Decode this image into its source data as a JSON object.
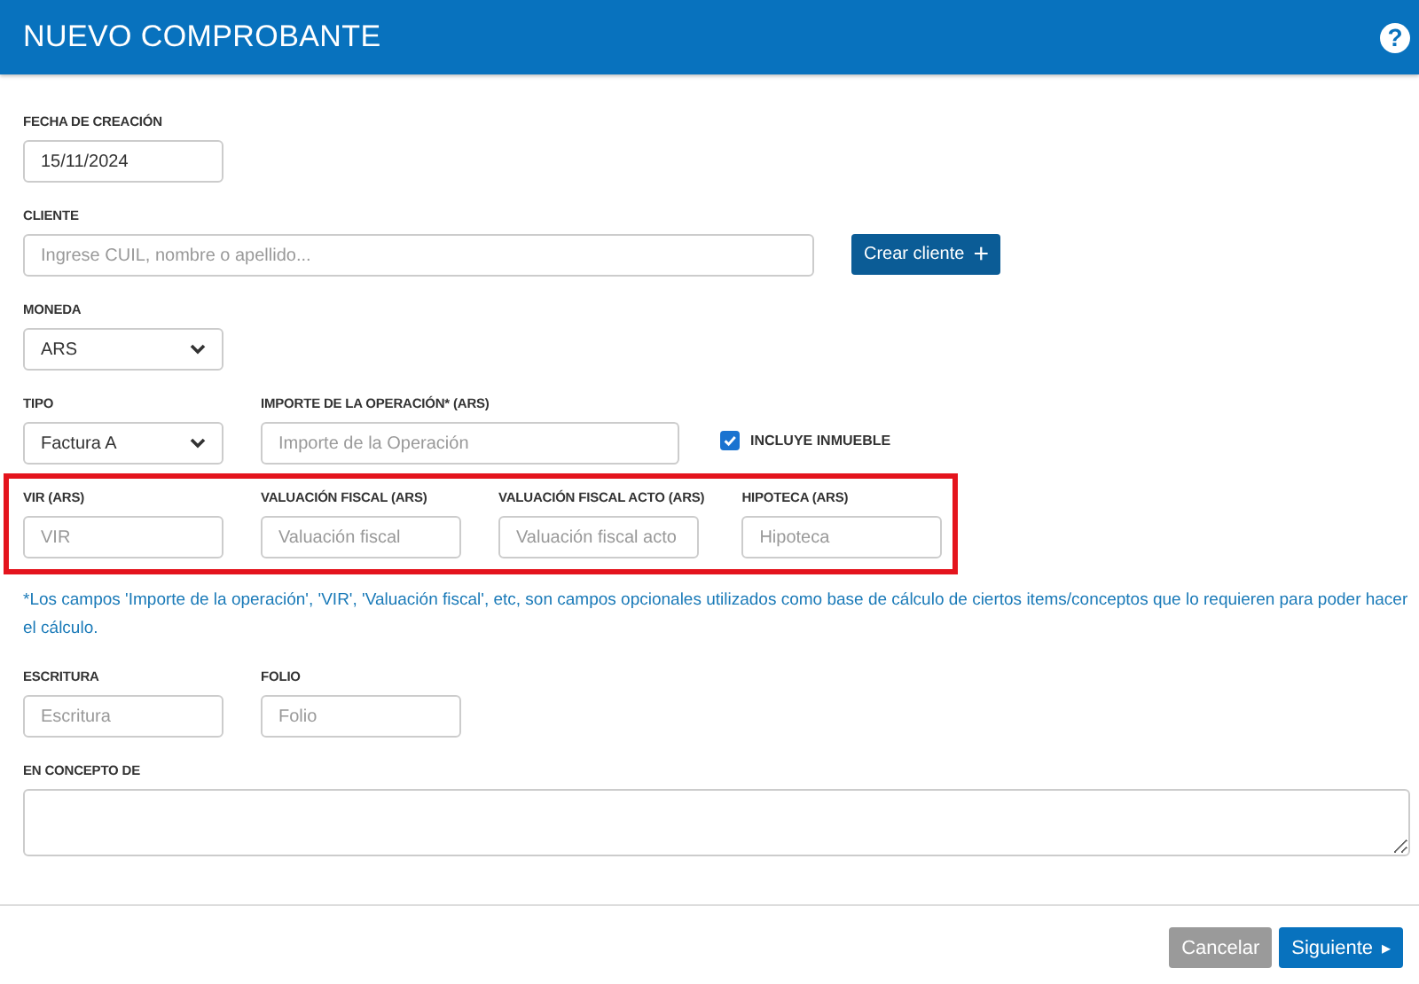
{
  "window": {
    "title": "NUEVO COMPROBANTE",
    "help": "?"
  },
  "rows": [
    {
      "kind": "fields",
      "items": [
        {
          "kind": "input",
          "label": "FECHA DE CREACIÓN",
          "value": "15/11/2024"
        }
      ]
    },
    {
      "kind": "fields",
      "items": [
        {
          "kind": "input",
          "label": "CLIENTE",
          "placeholder": "Ingrese CUIL, nombre o apellido..."
        },
        {
          "kind": "button",
          "label": "Crear cliente",
          "icon": "+"
        }
      ]
    },
    {
      "kind": "fields",
      "items": [
        {
          "kind": "select",
          "label": "MONEDA",
          "value": "ARS"
        }
      ]
    },
    {
      "kind": "fields",
      "items": [
        {
          "kind": "select",
          "label": "TIPO",
          "value": "Factura A"
        },
        {
          "kind": "input",
          "label": "IMPORTE DE LA OPERACIÓN* (ARS)",
          "placeholder": "Importe de la Operación"
        },
        {
          "kind": "checkbox",
          "label": "INCLUYE INMUEBLE",
          "checked": true
        }
      ]
    },
    {
      "kind": "fields",
      "highlighted": true,
      "items": [
        {
          "kind": "input",
          "label": "VIR (ARS)",
          "placeholder": "VIR"
        },
        {
          "kind": "input",
          "label": "VALUACIÓN FISCAL (ARS)",
          "placeholder": "Valuación fiscal"
        },
        {
          "kind": "input",
          "label": "VALUACIÓN FISCAL ACTO (ARS)",
          "placeholder": "Valuación fiscal acto"
        },
        {
          "kind": "input",
          "label": "HIPOTECA (ARS)",
          "placeholder": "Hipoteca"
        }
      ]
    },
    {
      "kind": "note",
      "text": "*Los campos 'Importe de la operación', 'VIR', 'Valuación fiscal', etc, son campos opcionales utilizados como base de cálculo de ciertos items/conceptos que lo requieren para poder hacer el cálculo."
    },
    {
      "kind": "fields",
      "items": [
        {
          "kind": "input",
          "label": "ESCRITURA",
          "placeholder": "Escritura"
        },
        {
          "kind": "input",
          "label": "FOLIO",
          "placeholder": "Folio"
        }
      ]
    },
    {
      "kind": "fields",
      "items": [
        {
          "kind": "textarea",
          "label": "EN CONCEPTO DE"
        }
      ]
    }
  ],
  "footer": {
    "buttons": [
      {
        "label": "Cancelar",
        "kind": "secondary"
      },
      {
        "label": "Siguiente",
        "kind": "primary",
        "icon": "▸"
      }
    ]
  }
}
